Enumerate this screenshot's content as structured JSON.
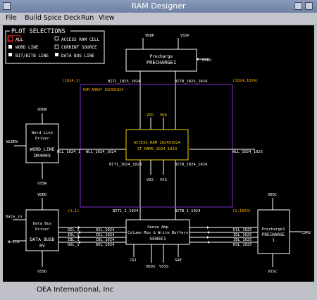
{
  "window": {
    "title": "RAM Designer"
  },
  "menu": [
    "File",
    "Build Spice Deck",
    "Run",
    "View"
  ],
  "plot_selections": {
    "title": "PLOT SELECTIONS",
    "options": [
      {
        "label": "ALL",
        "selected": true
      },
      {
        "label": "ACCESS RAM CELL",
        "selected": false
      },
      {
        "label": "WORD LINE",
        "selected": false
      },
      {
        "label": "CURRENT SOURCE",
        "selected": false
      },
      {
        "label": "BIT/BITB LINE",
        "selected": false
      },
      {
        "label": "DATA BUS LINE",
        "selected": false
      }
    ]
  },
  "schematic": {
    "precharge_top": {
      "line1": "Precharge",
      "line2": "PRECHARGE1",
      "vddp": "VDDP",
      "vssp": "VSSP",
      "pdrv": "PDRV"
    },
    "bit_labels_top": {
      "bit": "BIT1_1025_1024",
      "bitb": "BITB_1025_1024"
    },
    "corners": {
      "tl": "(1024,1)",
      "tr": "(1024,1024)",
      "bl": "(1,1)",
      "br": "(1,1024)"
    },
    "array_label": "RAM ARRAY 1024X1024",
    "word_driver": {
      "line1": "Word Line",
      "line2": "Driver",
      "line3": "WORD_LINE",
      "line4": "DR400X",
      "vddw": "VDDW",
      "vssw": "VSSW",
      "wldrv": "WLDRV"
    },
    "wll_left_outer": "WLL_1024_1",
    "wll_left_inner": "WLL_1024_1024",
    "wll_right": "WLL_1024_1025",
    "access": {
      "line1": "ACCESS RAM 1024X1024",
      "line2": "ST_RAMS_1024_1024",
      "vid": "VID",
      "vdd": "VDD",
      "vss1": "VSS",
      "vss2": "VSS"
    },
    "bit_mid": {
      "bit": "BIT1_1024_1024",
      "bitb": "BITB_1024_1024"
    },
    "bit_bottom": {
      "bit": "BIT1_1_1024",
      "bitb": "BITB_1_1024"
    },
    "data_driver": {
      "line1": "Data Bus",
      "line2": "Driver",
      "line3": "DATA_BUSD",
      "line4": "RV",
      "vddd": "VDDD",
      "vssd": "VSSD",
      "data_in": "Data_in",
      "write": "Write"
    },
    "bus_left": [
      "DIL_1",
      "IDL_1",
      "IBL_1",
      "DOL_1"
    ],
    "bus_mid": [
      "DIL_1024",
      "IDL_1024",
      "IBL_1024",
      "DOL_1024"
    ],
    "bus_right": [
      "DIL_1025",
      "IDL_1025",
      "IBL_1025",
      "DOL_1025"
    ],
    "sense": {
      "line1": "Sense Amp",
      "line2": "Column Mux & Write Buffers",
      "line3": "SENSE1",
      "cd1": "CD1",
      "vdds": "VDDS",
      "vsss": "VSSS",
      "sae": "SAE"
    },
    "precharge_right": {
      "line1": "Precharge1",
      "line2": "PRECHARGE",
      "line3": "1",
      "vddc": "VDDC",
      "vssc": "VSSC",
      "cdrv": "CDRV"
    }
  },
  "status": {
    "text": "OEA International, Inc"
  },
  "colors": {
    "background": "#000000",
    "lines": "#ffffff",
    "labels": "#ffffff",
    "coords": "#ffaa00",
    "array_frame": "#7a32c8",
    "access_frame": "#f0d000"
  }
}
